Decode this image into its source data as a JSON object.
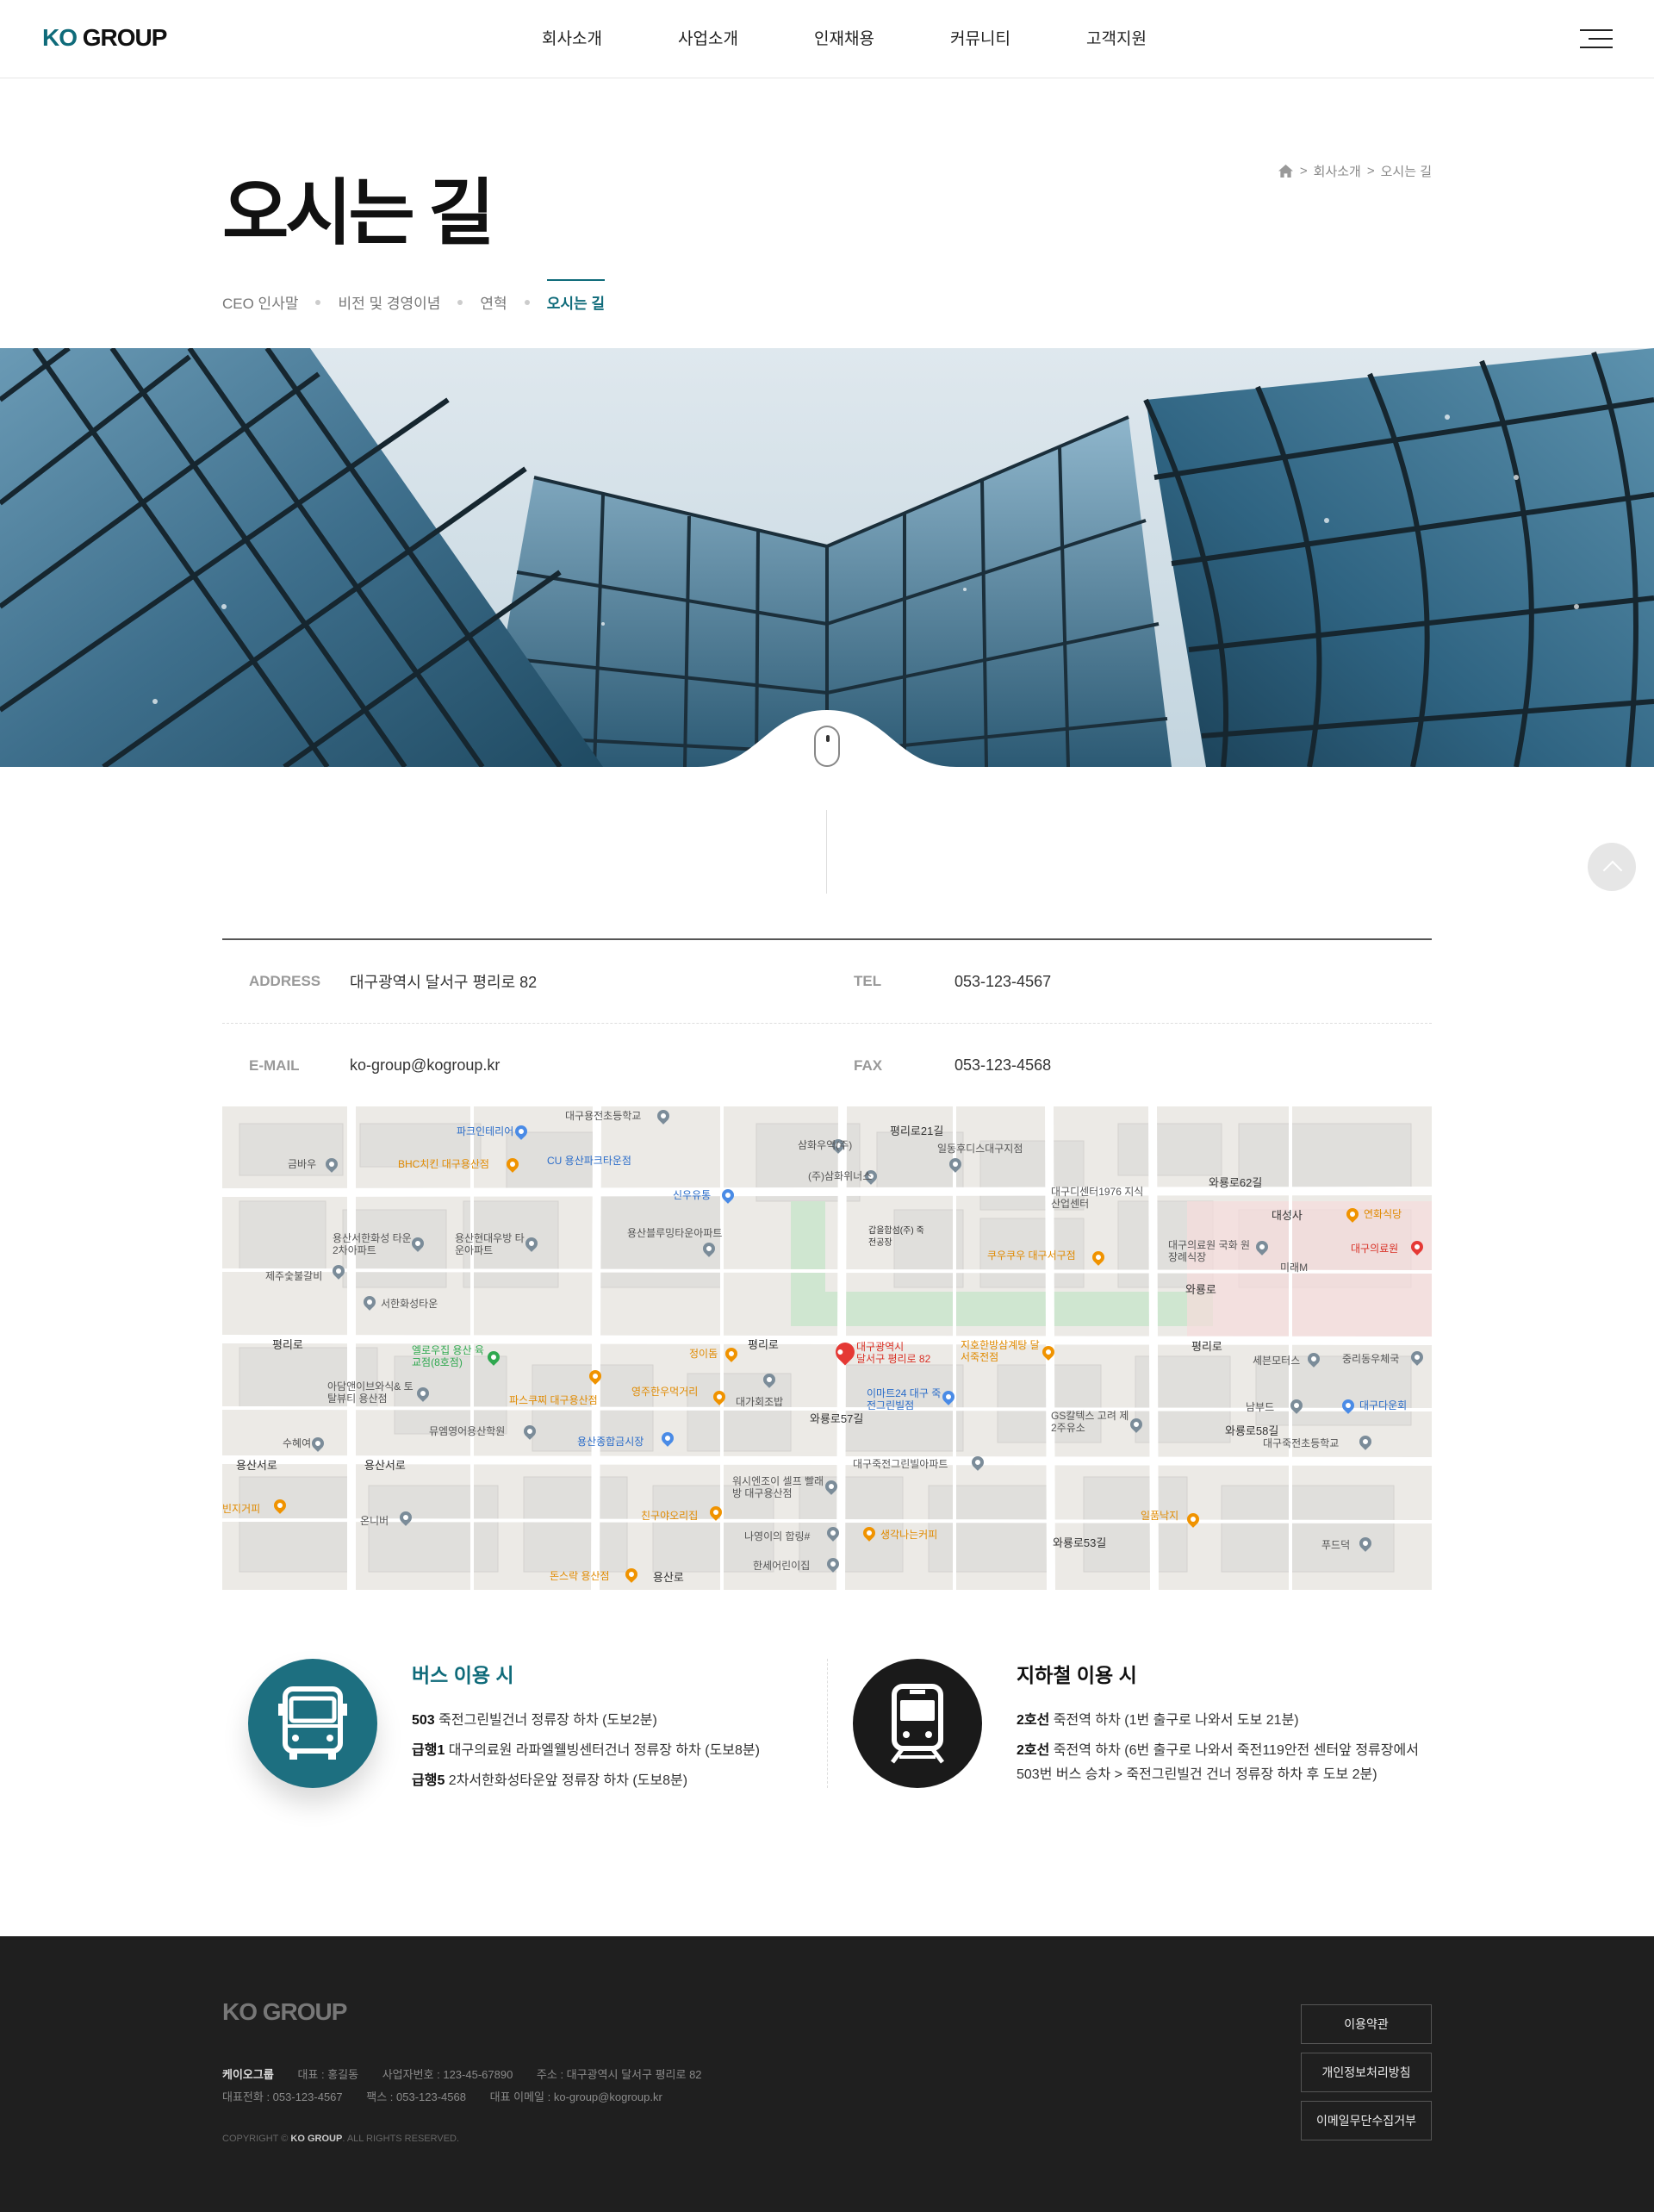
{
  "header": {
    "logo_ko": "KO",
    "logo_group": "GROUP",
    "nav": [
      "회사소개",
      "사업소개",
      "인재채용",
      "커뮤니티",
      "고객지원"
    ]
  },
  "page": {
    "title": "오시는 길",
    "breadcrumb": [
      "회사소개",
      "오시는 길"
    ],
    "subnav": [
      "CEO 인사말",
      "비전 및 경영이념",
      "연혁",
      "오시는 길"
    ]
  },
  "info": {
    "address_label": "ADDRESS",
    "address": "대구광역시 달서구 평리로 82",
    "tel_label": "TEL",
    "tel": "053-123-4567",
    "email_label": "E-MAIL",
    "email": "ko-group@kogroup.kr",
    "fax_label": "FAX",
    "fax": "053-123-4568"
  },
  "map": {
    "marker_line1": "대구광역시",
    "marker_line2": "달서구 평리로 82",
    "labels": [
      "대구용전초등학교",
      "파크인테리어",
      "삼화우역(주)",
      "평리로21길",
      "일동후디스대구지점",
      "금바우",
      "BHC치킨 대구용산점",
      "CU 용산파크타운점",
      "(주)삼화위너스",
      "신우유통",
      "대구디센터1976 지식산업센터",
      "와룡로62길",
      "대성사",
      "연화식당",
      "용산서한화성 타운2차아파트",
      "용산현대우방 타운아파트",
      "용산블루밍타운아파트",
      "갑을합섬(주) 죽전공장",
      "쿠우쿠우 대구서구점",
      "대구의료원 국화 원장례식장",
      "대구의료원",
      "제주숯불갈비",
      "서한화성타운",
      "미래M",
      "와룡로",
      "평리로",
      "엘로우집 용산 육교점(8호점)",
      "정이돔",
      "지호한방삼계탕 달서죽전점",
      "세븐모터스",
      "중리동우체국",
      "아담앤이브와식& 토탈뷰티 용산점",
      "파스쿠찌 대구용산점",
      "영주한우먹거리",
      "대가회조밥",
      "이마트24 대구 죽전그린빌점",
      "와룡로57길",
      "GS칼텍스 고려 제2주유소",
      "남부드",
      "대구다운회",
      "수혜여",
      "뮤엠영어용산학원",
      "용산종합금시장",
      "와룡로58길",
      "대구죽전초등학교",
      "용산서로",
      "대구죽전그린빌아파트",
      "워시엔조이 셀프 빨래방 대구용산점",
      "빈지거피",
      "온니버",
      "친구야오리집",
      "생각나는커피",
      "일품낙지",
      "나영이의 합링#",
      "푸드덕",
      "와룡로53길",
      "돈스락 용산점",
      "한세어린이집",
      "용산로"
    ]
  },
  "transport": {
    "bus_title": "버스 이용 시",
    "bus": [
      {
        "route": "503",
        "desc": "죽전그린빌건너 정류장 하차 (도보2분)"
      },
      {
        "route": "급행1",
        "desc": "대구의료원 라파엘웰빙센터건너 정류장 하차 (도보8분)"
      },
      {
        "route": "급행5",
        "desc": "2차서한화성타운앞 정류장 하차 (도보8분)"
      }
    ],
    "subway_title": "지하철 이용 시",
    "subway": [
      {
        "route": "2호선",
        "desc": "죽전역 하차 (1번 출구로 나와서 도보 21분)"
      },
      {
        "route": "2호선",
        "desc": "죽전역 하차 (6번 출구로 나와서 죽전119안전 센터앞 정류장에서 503번 버스 승차 > 죽전그린빌건 건너 정류장 하차 후 도보 2분)"
      }
    ]
  },
  "footer": {
    "logo": "KO GROUP",
    "company": "케이오그룹",
    "ceo": "대표 : 홍길동",
    "biz_no": "사업자번호 : 123-45-67890",
    "address": "주소 : 대구광역시 달서구 평리로 82",
    "phone": "대표전화 : 053-123-4567",
    "fax": "팩스 : 053-123-4568",
    "email": "대표 이메일 : ko-group@kogroup.kr",
    "copyright_pre": "COPYRIGHT ©",
    "copyright_brand": "KO GROUP",
    "copyright_post": ". ALL RIGHTS RESERVED.",
    "buttons": [
      "이용약관",
      "개인정보처리방침",
      "이메일무단수집거부"
    ]
  },
  "colors": {
    "accent": "#0f6b7a",
    "footer_bg": "#1f1f1f",
    "subway_circle": "#1a1a1a"
  },
  "icons": [
    "menu-icon",
    "home-icon",
    "mouse-scroll-icon",
    "top-arrow-icon",
    "bus-icon",
    "subway-icon",
    "map-pin-icon"
  ]
}
